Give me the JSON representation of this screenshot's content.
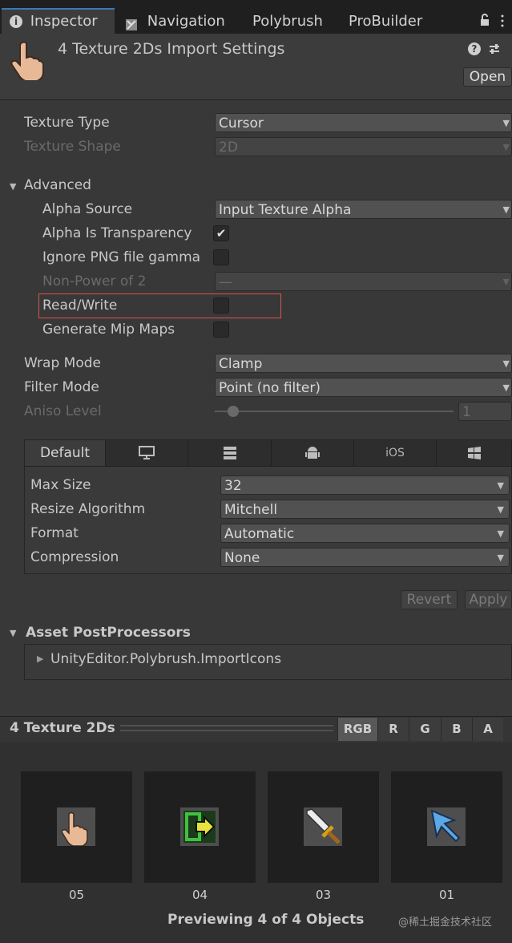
{
  "tabs": [
    {
      "label": "Inspector",
      "icon": "info-icon"
    },
    {
      "label": "Navigation",
      "icon": "navigation-icon"
    },
    {
      "label": "Polybrush"
    },
    {
      "label": "ProBuilder"
    }
  ],
  "header": {
    "title": "4 Texture 2Ds Import Settings",
    "open_label": "Open"
  },
  "fields": {
    "texture_type": {
      "label": "Texture Type",
      "value": "Cursor"
    },
    "texture_shape": {
      "label": "Texture Shape",
      "value": "2D"
    },
    "advanced_label": "Advanced",
    "alpha_source": {
      "label": "Alpha Source",
      "value": "Input Texture Alpha"
    },
    "alpha_is_transparency": {
      "label": "Alpha Is Transparency",
      "checked": true
    },
    "ignore_png_gamma": {
      "label": "Ignore PNG file gamma",
      "checked": false
    },
    "non_power_of_2": {
      "label": "Non-Power of 2",
      "value": "—"
    },
    "read_write": {
      "label": "Read/Write",
      "checked": false
    },
    "generate_mip_maps": {
      "label": "Generate Mip Maps",
      "checked": false
    },
    "wrap_mode": {
      "label": "Wrap Mode",
      "value": "Clamp"
    },
    "filter_mode": {
      "label": "Filter Mode",
      "value": "Point (no filter)"
    },
    "aniso_level": {
      "label": "Aniso Level",
      "value": "1"
    }
  },
  "platform": {
    "tabs": [
      "Default",
      "",
      "",
      "",
      "iOS",
      ""
    ],
    "max_size": {
      "label": "Max Size",
      "value": "32"
    },
    "resize_algorithm": {
      "label": "Resize Algorithm",
      "value": "Mitchell"
    },
    "format": {
      "label": "Format",
      "value": "Automatic"
    },
    "compression": {
      "label": "Compression",
      "value": "None"
    }
  },
  "actions": {
    "revert": "Revert",
    "apply": "Apply"
  },
  "postprocessors": {
    "title": "Asset PostProcessors",
    "item": "UnityEditor.Polybrush.ImportIcons"
  },
  "preview": {
    "title": "4 Texture 2Ds",
    "channels": [
      "RGB",
      "R",
      "G",
      "B",
      "A"
    ],
    "thumbnails": [
      {
        "name": "05",
        "icon": "hand-cursor-icon"
      },
      {
        "name": "04",
        "icon": "exit-door-icon"
      },
      {
        "name": "03",
        "icon": "sword-icon"
      },
      {
        "name": "01",
        "icon": "arrow-cursor-icon"
      }
    ],
    "status": "Previewing 4 of 4 Objects"
  },
  "watermark": "@稀土掘金技术社区",
  "colors": {
    "highlight_border": "#d9534f",
    "active_tab_accent": "#3a79bb"
  }
}
